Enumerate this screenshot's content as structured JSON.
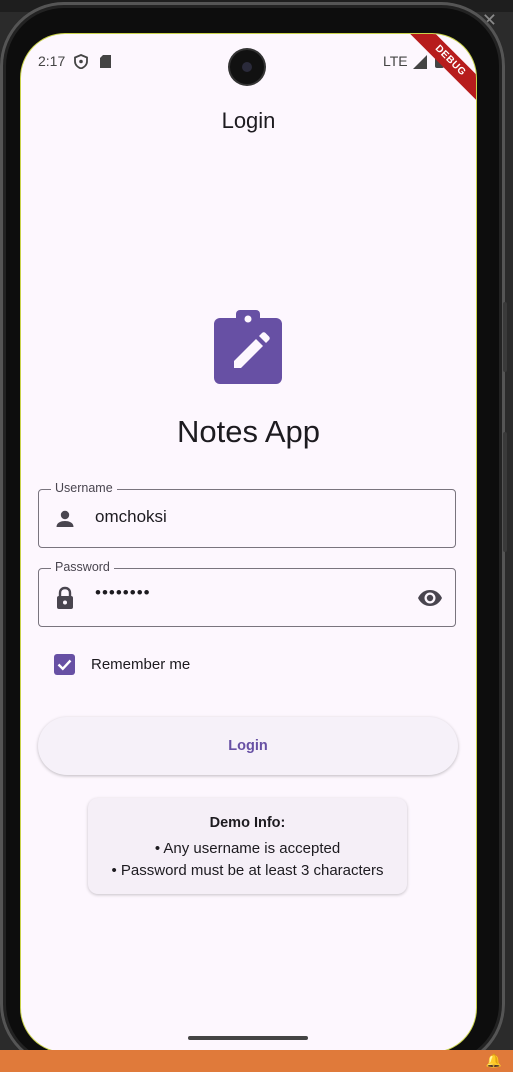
{
  "status_bar": {
    "time": "2:17",
    "network": "LTE",
    "icons": [
      "shield-icon",
      "sd-card-icon",
      "signal-icon",
      "battery-icon"
    ]
  },
  "debug_banner": "DEBUG",
  "app_bar": {
    "title": "Login"
  },
  "app": {
    "name": "Notes App",
    "icon": "clipboard-edit-icon",
    "accent": "#6750a4"
  },
  "form": {
    "username": {
      "label": "Username",
      "value": "omchoksi",
      "icon": "person-icon"
    },
    "password": {
      "label": "Password",
      "value": "••••••••",
      "icon": "lock-icon",
      "toggle_icon": "eye-icon"
    },
    "remember_me": {
      "label": "Remember me",
      "checked": true
    },
    "login_button": "Login"
  },
  "demo_info": {
    "title": "Demo Info:",
    "lines": [
      "• Any username is accepted",
      "• Password must be at least 3 characters"
    ]
  },
  "colors": {
    "background": "#fdf7fe",
    "primary": "#6750a4",
    "debug": "#b71c1c"
  }
}
